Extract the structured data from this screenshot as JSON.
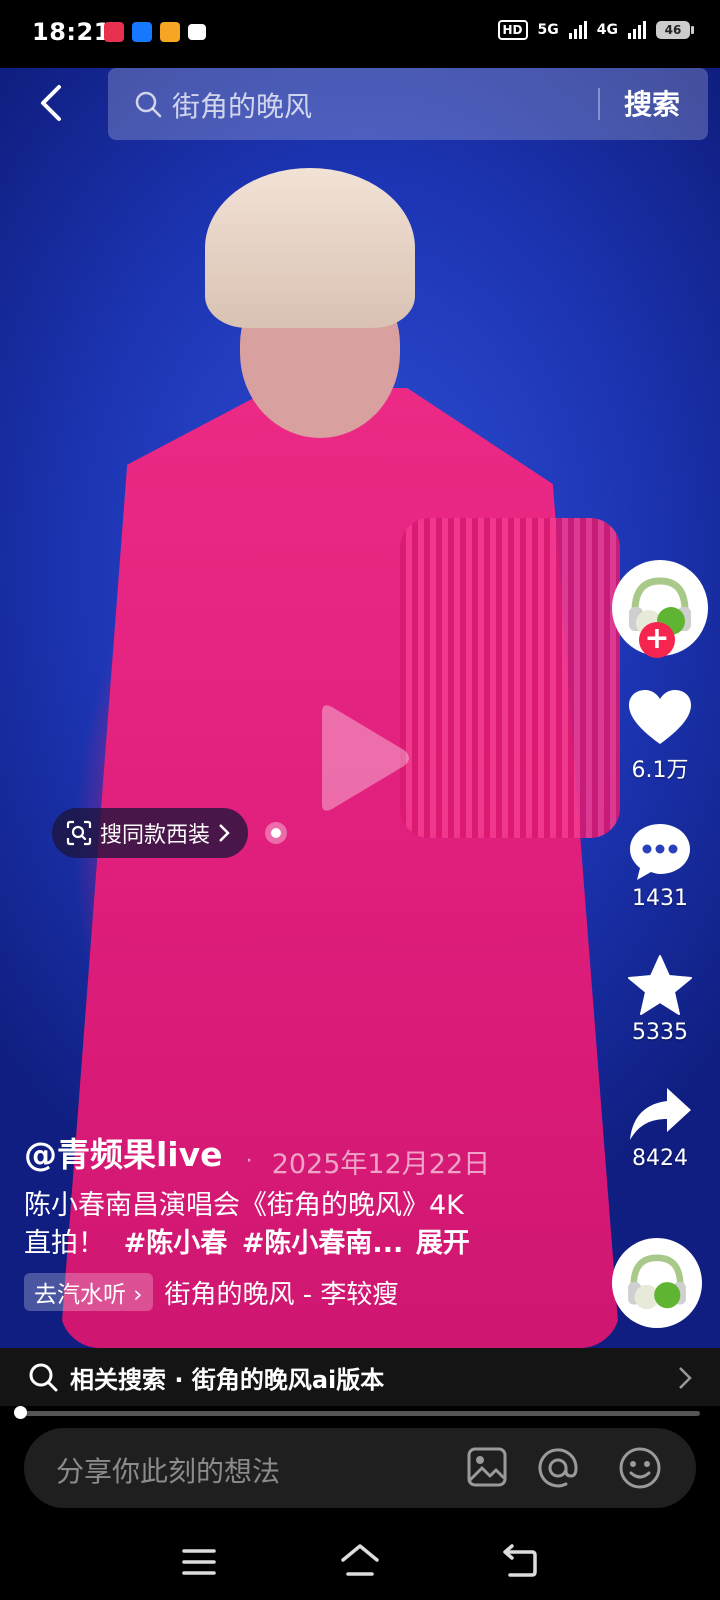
{
  "status_bar": {
    "time": "18:21",
    "hd": "HD",
    "net1": "5G",
    "net2": "4G",
    "battery": "46"
  },
  "search": {
    "query": "街角的晚风",
    "button_label": "搜索"
  },
  "video": {
    "chip_label": "搜同款西装"
  },
  "actions": {
    "likes": "6.1万",
    "comments": "1431",
    "favorites": "5335",
    "shares": "8424"
  },
  "post": {
    "author": "@青频果live",
    "date": "2025年12月22日",
    "desc_line1": "陈小春南昌演唱会《街角的晚风》4K",
    "desc_line2_prefix": "直拍！",
    "tag1": "#陈小春",
    "tag2": "#陈小春南...",
    "expand": "展开",
    "music_chip": "去汽水听",
    "music_title": "街角的晚风 - 李较瘦"
  },
  "related": {
    "text": "相关搜索 · 街角的晚风ai版本"
  },
  "comment": {
    "placeholder": "分享你此刻的想法"
  },
  "colors": {
    "accent_red": "#f5254f",
    "bg": "#000000"
  }
}
